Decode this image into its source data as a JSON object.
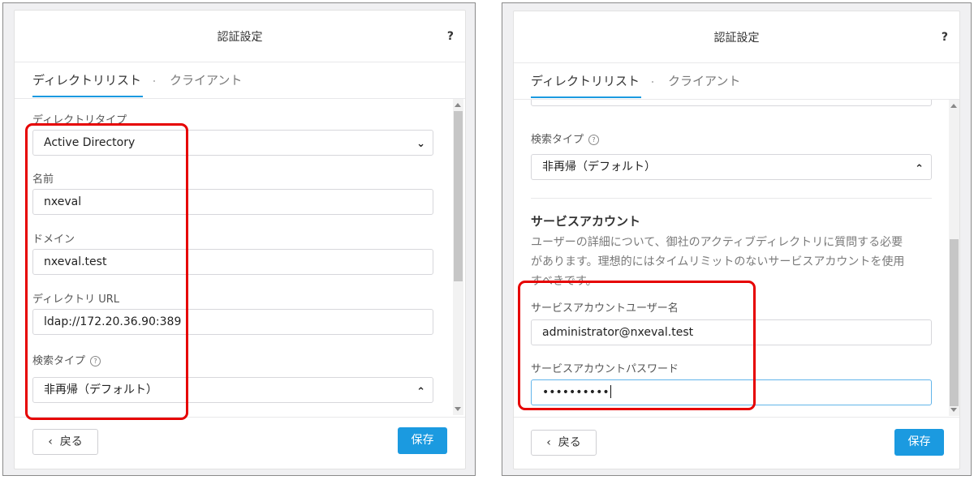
{
  "left_panel": {
    "title": "認証設定",
    "help": "?",
    "tabs": [
      "ディレクトリリスト",
      "クライアント"
    ],
    "fields": {
      "directory_type": {
        "label": "ディレクトリタイプ",
        "value": "Active Directory",
        "icon": "chevron-down-icon"
      },
      "name": {
        "label": "名前",
        "value": "nxeval"
      },
      "domain": {
        "label": "ドメイン",
        "value": "nxeval.test"
      },
      "directory_url": {
        "label": "ディレクトリ URL",
        "value": "ldap://172.20.36.90:389"
      },
      "search_type": {
        "label": "検索タイプ",
        "value": "非再帰（デフォルト）",
        "icon": "chevron-up-icon"
      }
    },
    "back_label": "戻る",
    "save_label": "保存"
  },
  "right_panel": {
    "title": "認証設定",
    "help": "?",
    "tabs": [
      "ディレクトリリスト",
      "クライアント"
    ],
    "fields": {
      "search_type": {
        "label": "検索タイプ",
        "value": "非再帰（デフォルト）",
        "icon": "chevron-up-icon"
      },
      "service_account_user": {
        "label": "サービスアカウントユーザー名",
        "value": "administrator@nxeval.test"
      },
      "service_account_password": {
        "label": "サービスアカウントパスワード",
        "value": "••••••••••"
      }
    },
    "service_account": {
      "heading": "サービスアカウント",
      "description_lines": [
        "ユーザーの詳細について、御社のアクティブディレクトリに質問する必要",
        "があります。理想的にはタイムリミットのないサービスアカウントを使用",
        "すべきです。"
      ]
    },
    "back_label": "戻る",
    "save_label": "保存"
  },
  "colors": {
    "accent": "#1b9ae0",
    "highlight": "#e60000"
  }
}
